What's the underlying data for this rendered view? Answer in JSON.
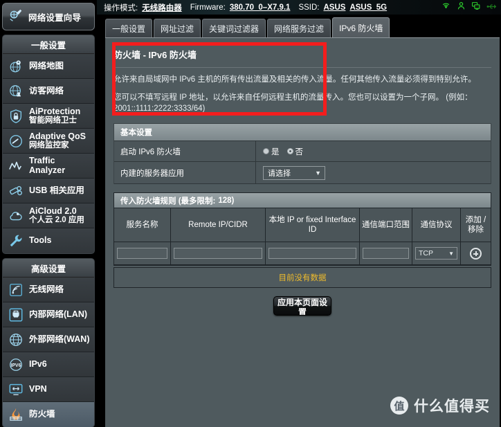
{
  "sidebar": {
    "wizard": {
      "label": "网络设置向导",
      "icon": "wizard-icon"
    },
    "groups": [
      {
        "title": "一般设置",
        "items": [
          {
            "label": "网络地图",
            "sub": "",
            "icon": "network-map-icon",
            "active": false
          },
          {
            "label": "访客网络",
            "sub": "",
            "icon": "guest-network-icon",
            "active": false
          },
          {
            "label": "AiProtection",
            "sub": "智能网络卫士",
            "icon": "shield-lock-icon",
            "active": false
          },
          {
            "label": "Adaptive QoS",
            "sub": "网络监控家",
            "icon": "gauge-icon",
            "active": false
          },
          {
            "label": "Traffic",
            "sub": "Analyzer",
            "icon": "traffic-analyzer-icon",
            "active": false
          },
          {
            "label": "USB 相关应用",
            "sub": "",
            "icon": "usb-icon",
            "active": false
          },
          {
            "label": "AiCloud 2.0",
            "sub": "个人云 2.0 应用",
            "icon": "cloud-icon",
            "active": false
          },
          {
            "label": "Tools",
            "sub": "",
            "icon": "wrench-icon",
            "active": false
          }
        ]
      },
      {
        "title": "高级设置",
        "items": [
          {
            "label": "无线网络",
            "sub": "",
            "icon": "wireless-icon",
            "active": false
          },
          {
            "label": "内部网络(LAN)",
            "sub": "",
            "icon": "lan-icon",
            "active": false
          },
          {
            "label": "外部网络(WAN)",
            "sub": "",
            "icon": "wan-globe-icon",
            "active": false
          },
          {
            "label": "IPv6",
            "sub": "",
            "icon": "ipv6-icon",
            "active": false
          },
          {
            "label": "VPN",
            "sub": "",
            "icon": "vpn-icon",
            "active": false
          },
          {
            "label": "防火墙",
            "sub": "",
            "icon": "firewall-flame-icon",
            "active": true
          }
        ]
      }
    ]
  },
  "topbar": {
    "mode_label": "操作模式:",
    "mode_value": "无线路由器",
    "firmware_label": "Firmware:",
    "firmware_value": "380.70_0–X7.9.1",
    "ssid_label": "SSID:",
    "ssid_1": "ASUS",
    "ssid_2": "ASUS_5G",
    "icons": [
      "wifi-icon",
      "user-icon",
      "clients-monitor-icon",
      "usb-port-icon"
    ],
    "icon_color": "#2dd02d"
  },
  "tabs": [
    {
      "label": "一般设置",
      "active": false
    },
    {
      "label": "网址过滤",
      "active": false
    },
    {
      "label": "关键词过滤器",
      "active": false
    },
    {
      "label": "网络服务过滤",
      "active": false
    },
    {
      "label": "IPv6 防火墙",
      "active": true
    }
  ],
  "page": {
    "title": "防火墙 - IPv6 防火墙",
    "desc_line1": "允许来自局域网中 IPv6 主机的所有传出流量及相关的传入流量。任何其他传入流量必须得到特别允许。",
    "desc_line2": "您可以不填写远程 IP 地址，以允许来自任何远程主机的流量传入。您也可以设置为一个子网。 (例如：",
    "desc_line3": "2001::1111:2222:3333/64)"
  },
  "basic": {
    "section_title": "基本设置",
    "rows": [
      {
        "label": "启动 IPv6 防火墙",
        "type": "radio",
        "options": [
          {
            "label": "是",
            "selected": false
          },
          {
            "label": "否",
            "selected": true
          }
        ]
      },
      {
        "label": "内建的服务器应用",
        "type": "select",
        "value": "请选择"
      }
    ]
  },
  "rules": {
    "title": "传入防火墙规则 (最多限制:",
    "limit": "128)",
    "columns": [
      "服务名称",
      "Remote IP/CIDR",
      "本地 IP or fixed Interface ID",
      "通信端口范围",
      "通信协议",
      "添加 / 移除"
    ],
    "input_row": {
      "service_name": "",
      "remote_ip": "",
      "local_ip": "",
      "port_range": "",
      "protocol": "TCP",
      "add_icon": "plus-circle-icon"
    },
    "empty_message": "目前没有数据"
  },
  "apply_button": {
    "label": "应用本页面设置"
  },
  "annotation": {
    "color": "#f41d1d",
    "shape": "rectangle"
  },
  "watermark": {
    "badge": "值",
    "text": "什么值得买"
  }
}
